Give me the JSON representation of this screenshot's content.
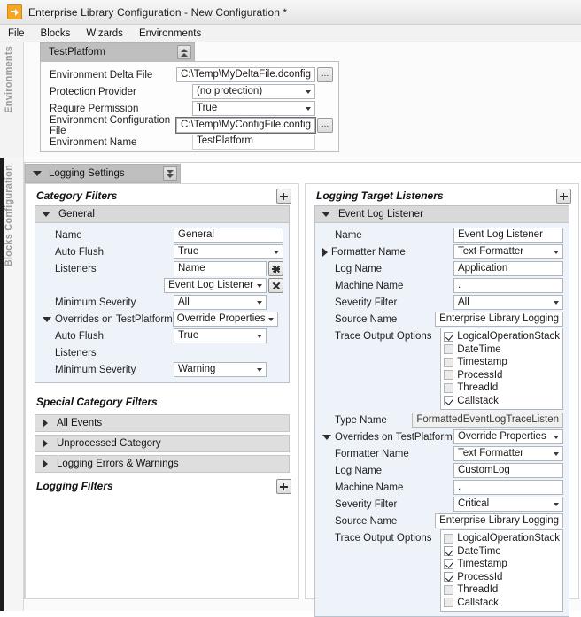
{
  "window": {
    "title": "Enterprise Library Configuration - New Configuration *",
    "icon": "enterprise-library-icon"
  },
  "menubar": {
    "items": [
      "File",
      "Blocks",
      "Wizards",
      "Environments"
    ]
  },
  "rails": {
    "environments_label": "Environments",
    "blocks_label": "Blocks Configuration"
  },
  "environments_panel": {
    "header": "TestPlatform",
    "collapse_icon": "chevron-double-up-icon",
    "rows": [
      {
        "label": "Environment Delta File",
        "type": "text-with-browse",
        "value": "C:\\Temp\\MyDeltaFile.dconfig",
        "browse_label": "..."
      },
      {
        "label": "Protection Provider",
        "type": "combo",
        "value": "(no protection)"
      },
      {
        "label": "Require Permission",
        "type": "combo",
        "value": "True"
      },
      {
        "label": "Environment Configuration File",
        "type": "text-with-browse",
        "value": "C:\\Temp\\MyConfigFile.config",
        "browse_label": "...",
        "focused": true
      },
      {
        "label": "Environment Name",
        "type": "text",
        "value": "TestPlatform"
      }
    ]
  },
  "logging_settings": {
    "header": "Logging Settings",
    "expand_icon": "chevron-double-down-icon",
    "collapse_triangle": "triangle-down-icon"
  },
  "category_filters": {
    "title": "Category Filters",
    "add_icon": "plus-icon",
    "card": {
      "title": "General",
      "toggle_icon": "triangle-down-icon",
      "rows": [
        {
          "label": "Name",
          "type": "text",
          "value": "General"
        },
        {
          "label": "Auto Flush",
          "type": "combo",
          "value": "True"
        },
        {
          "label": "Listeners",
          "type": "listeners-header",
          "value": "Name",
          "add_icon": "plus-icon"
        },
        {
          "label": "",
          "type": "listener-item",
          "value": "Event Log Listener",
          "remove_icon": "x-icon"
        },
        {
          "label": "Minimum Severity",
          "type": "combo",
          "value": "All"
        },
        {
          "label": "Overrides on TestPlatform",
          "type": "combo",
          "value": "Override Properties",
          "toggle_icon": "triangle-down-icon"
        },
        {
          "label": "Auto Flush",
          "type": "combo",
          "value": "True"
        },
        {
          "label": "Listeners",
          "type": "empty"
        },
        {
          "label": "Minimum Severity",
          "type": "combo",
          "value": "Warning"
        }
      ]
    }
  },
  "special_category_filters": {
    "title": "Special Category Filters",
    "items": [
      {
        "label": "All Events",
        "toggle_icon": "triangle-right-icon"
      },
      {
        "label": "Unprocessed Category",
        "toggle_icon": "triangle-right-icon"
      },
      {
        "label": "Logging Errors & Warnings",
        "toggle_icon": "triangle-right-icon"
      }
    ]
  },
  "logging_filters": {
    "title": "Logging Filters",
    "add_icon": "plus-icon"
  },
  "logging_target_listeners": {
    "title": "Logging Target Listeners",
    "add_icon": "plus-icon",
    "card": {
      "title": "Event Log Listener",
      "toggle_icon": "triangle-down-icon",
      "rows": [
        {
          "label": "Name",
          "type": "text",
          "value": "Event Log Listener"
        },
        {
          "label": "Formatter Name",
          "type": "combo",
          "value": "Text Formatter",
          "toggle_icon": "triangle-right-icon"
        },
        {
          "label": "Log Name",
          "type": "text",
          "value": "Application"
        },
        {
          "label": "Machine Name",
          "type": "text",
          "value": "."
        },
        {
          "label": "Severity Filter",
          "type": "combo",
          "value": "All"
        },
        {
          "label": "Source Name",
          "type": "text",
          "value": "Enterprise Library Logging"
        },
        {
          "label": "Trace Output Options",
          "type": "checkbox-list",
          "options": [
            {
              "label": "LogicalOperationStack",
              "checked": true
            },
            {
              "label": "DateTime",
              "checked": false
            },
            {
              "label": "Timestamp",
              "checked": false
            },
            {
              "label": "ProcessId",
              "checked": false
            },
            {
              "label": "ThreadId",
              "checked": false
            },
            {
              "label": "Callstack",
              "checked": true
            }
          ]
        },
        {
          "label": "Type Name",
          "type": "text-readonly",
          "value": "FormattedEventLogTraceListen"
        },
        {
          "label": "Overrides on TestPlatform",
          "type": "combo",
          "value": "Override Properties",
          "toggle_icon": "triangle-down-icon"
        },
        {
          "label": "Formatter Name",
          "type": "combo",
          "value": "Text Formatter"
        },
        {
          "label": "Log Name",
          "type": "text",
          "value": "CustomLog"
        },
        {
          "label": "Machine Name",
          "type": "text",
          "value": "."
        },
        {
          "label": "Severity Filter",
          "type": "combo",
          "value": "Critical"
        },
        {
          "label": "Source Name",
          "type": "text",
          "value": "Enterprise Library Logging"
        },
        {
          "label": "Trace Output Options",
          "type": "checkbox-list",
          "options": [
            {
              "label": "LogicalOperationStack",
              "checked": false
            },
            {
              "label": "DateTime",
              "checked": true
            },
            {
              "label": "Timestamp",
              "checked": true
            },
            {
              "label": "ProcessId",
              "checked": true
            },
            {
              "label": "ThreadId",
              "checked": false
            },
            {
              "label": "Callstack",
              "checked": false
            }
          ]
        }
      ]
    }
  },
  "colors": {
    "title_bar": "#eeeeee",
    "panel_header": "#bfbfbf",
    "card_body": "#eef3fa",
    "accent_icon": "#f5a623"
  }
}
